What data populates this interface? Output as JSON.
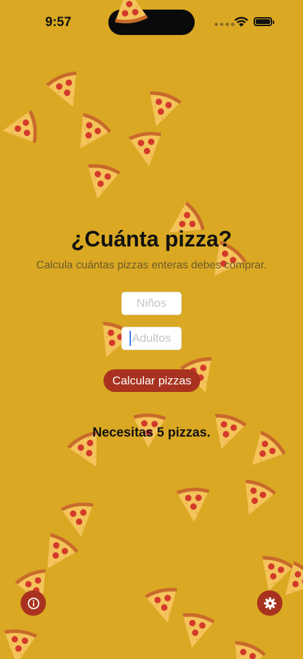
{
  "status_bar": {
    "time": "9:57",
    "battery_level": 0.85
  },
  "main": {
    "title": "¿Cuánta pizza?",
    "subtitle": "Calcula cuántas pizzas enteras debes comprar.",
    "kids_placeholder": "Niños",
    "adults_placeholder": "Adultos",
    "calculate_label": "Calcular pizzas",
    "result": "Necesitas 5 pizzas."
  },
  "bottom_bar": {
    "info_icon": "info-icon",
    "settings_icon": "gear-icon"
  },
  "colors": {
    "background": "#daa822",
    "accent": "#a8321f",
    "text": "#111111",
    "cursor": "#3478f6"
  },
  "decoration": {
    "icon": "pizza-slice-icon"
  }
}
